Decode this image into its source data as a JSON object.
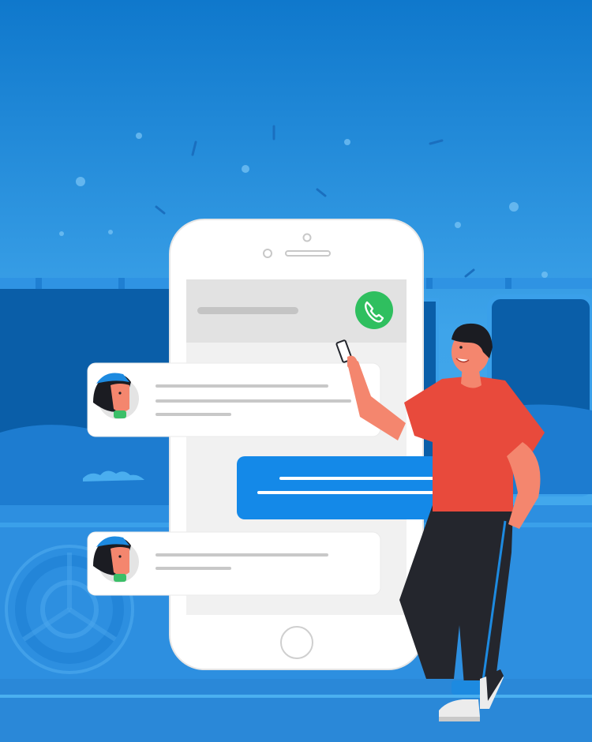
{
  "scene": {
    "description_label": "",
    "colors": {
      "sky_top": "#1177cc",
      "sky_bottom": "#4ab0ee",
      "deep_blue": "#0b5fa8",
      "panel_blue": "#2b8fe0",
      "phone_body": "#ffffff",
      "phone_screen": "#f1f1f1",
      "phone_header": "#e2e2e2",
      "call_green": "#2fbf5f",
      "sent_bubble": "#1489e8",
      "received_bubble": "#ffffff",
      "shirt": "#e84a3c",
      "pants": "#24262d",
      "skin": "#f4866e",
      "hair": "#1b1c22"
    },
    "icons": {
      "call": "phone-handset-icon",
      "avatar": "avatar-woman-icon",
      "home": "home-button-icon"
    },
    "messages": [
      {
        "direction": "received",
        "line_count": 3
      },
      {
        "direction": "sent",
        "line_count": 2
      },
      {
        "direction": "received",
        "line_count": 2
      }
    ]
  }
}
